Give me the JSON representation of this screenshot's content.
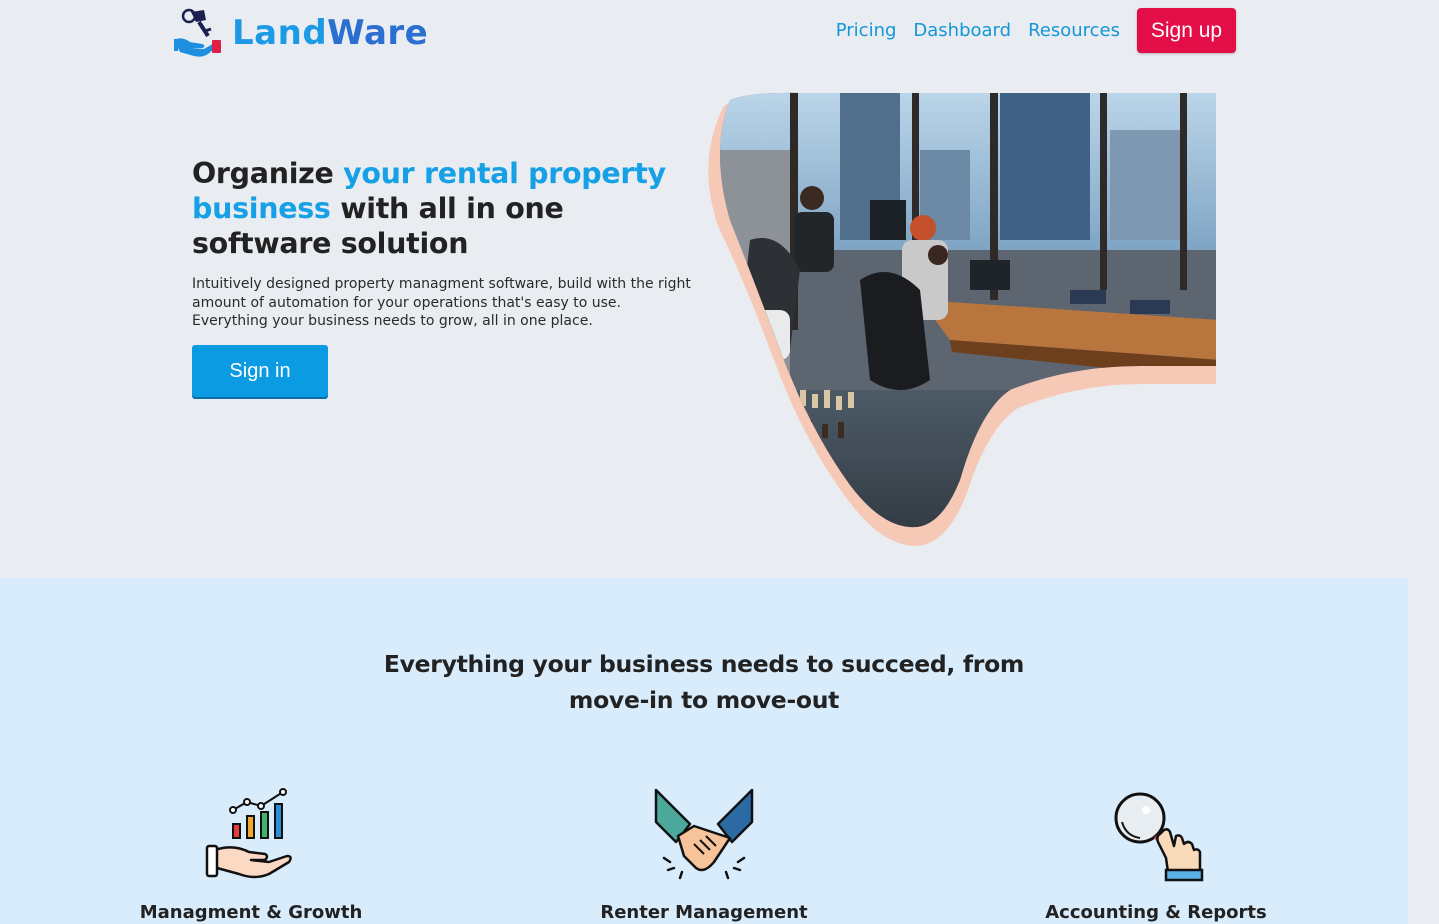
{
  "brand": {
    "name_part1": "Land",
    "name_part2": "Ware"
  },
  "nav": {
    "links": [
      "Pricing",
      "Dashboard",
      "Resources"
    ],
    "signup_label": "Sign up"
  },
  "hero": {
    "title_part1": "Organize ",
    "title_highlight": "your rental property business",
    "title_part2": " with all in one software solution",
    "description": "Intuitively designed property managment software, build with the right amount of automation for your operations that's easy to use. Everything your business needs to grow, all in one place.",
    "signin_label": "Sign in"
  },
  "features": {
    "title": "Everything your business needs to succeed, from move-in to move-out",
    "items": [
      {
        "label": "Managment & Growth",
        "icon": "growth-chart-hand-icon"
      },
      {
        "label": "Renter Management",
        "icon": "handshake-icon"
      },
      {
        "label": "Accounting & Reports",
        "icon": "magnifier-hand-icon"
      }
    ]
  },
  "colors": {
    "accent": "#16a0e5",
    "signup": "#e30d48",
    "page_bg": "#e9ecf1",
    "features_bg": "#d9ecfc"
  }
}
